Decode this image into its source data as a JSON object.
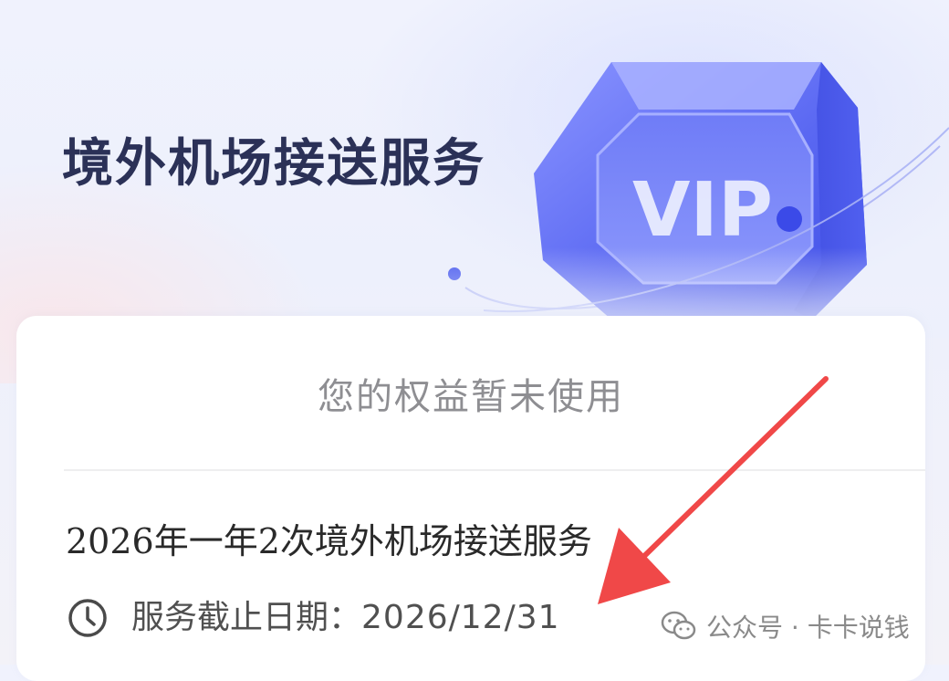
{
  "hero": {
    "title": "境外机场接送服务",
    "badge_text": "VIP",
    "badge_icon": "vip-gem-icon"
  },
  "card": {
    "status": "您的权益暂未使用",
    "service_name": "2026年一年2次境外机场接送服务",
    "deadline_label": "服务截止日期：",
    "deadline_value": "2026/12/31",
    "deadline_icon": "clock-icon"
  },
  "annotation": {
    "arrow_color": "#f04848",
    "arrow_icon": "red-arrow-icon"
  },
  "watermark": {
    "text": "公众号 · 卡卡说钱",
    "icon": "wechat-icon"
  },
  "colors": {
    "title": "#2b3157",
    "accent": "#4a5cf0",
    "status_text": "#8e8e92",
    "card_background": "#ffffff"
  }
}
